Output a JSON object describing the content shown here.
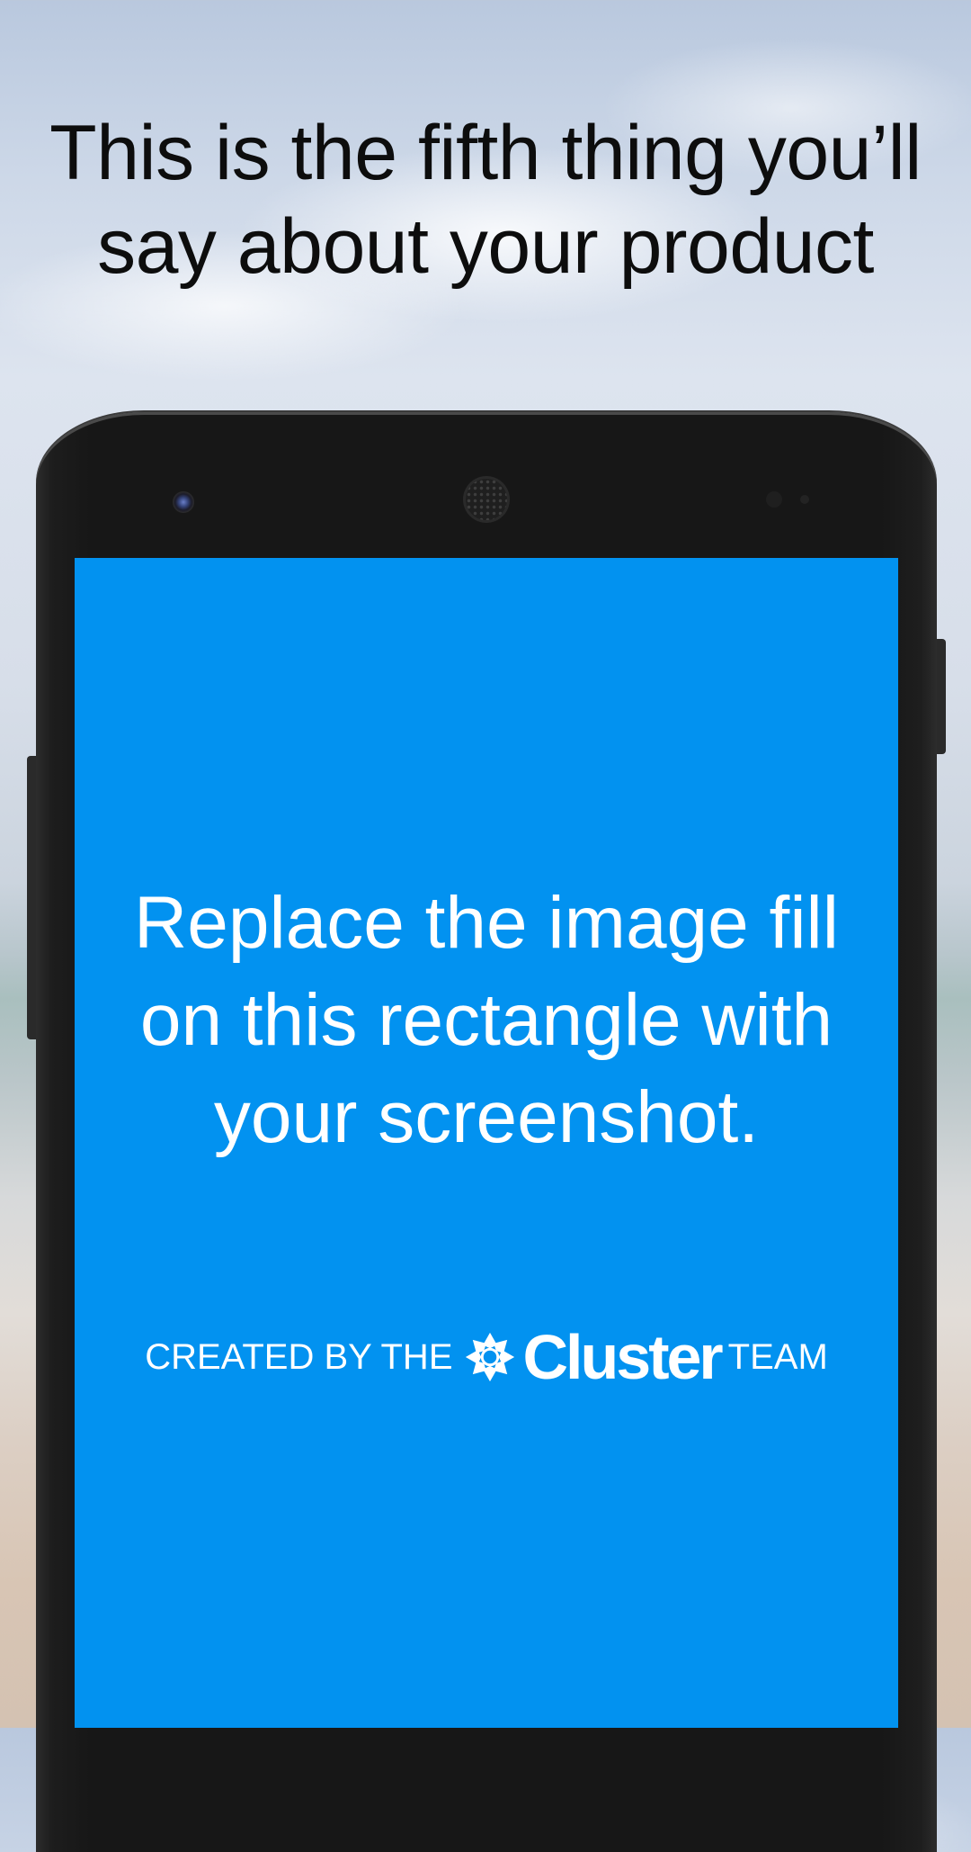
{
  "headline": {
    "line1": "This is the fifth thing you’ll",
    "line2": "say about your product"
  },
  "screen": {
    "background_color": "#0292f0",
    "placeholder": {
      "line1": "Replace the image fill",
      "line2": "on this rectangle with",
      "line3": "your screenshot."
    },
    "credit": {
      "prefix": "CREATED BY THE",
      "logo_icon": "cluster-logo-icon",
      "brand": "Cluster",
      "suffix": "TEAM"
    }
  },
  "device": {
    "type": "android-phone",
    "color": "#171717"
  }
}
